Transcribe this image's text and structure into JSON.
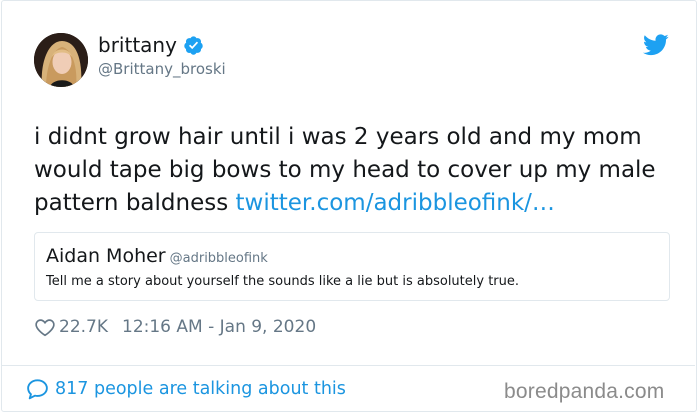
{
  "user": {
    "display_name": "brittany",
    "handle": "@Brittany_broski",
    "avatar_icon": "user-avatar-photo",
    "verified_icon": "verified-badge-icon"
  },
  "brand": {
    "bird_icon": "twitter-bird-icon",
    "accent_color": "#1b95e0"
  },
  "tweet": {
    "text": "i didnt grow hair until i was 2 years old and my mom would tape big bows to my head to cover up my male pattern baldness ",
    "link": "twitter.com/adribbleofink/…"
  },
  "quoted_tweet": {
    "name": "Aidan Moher",
    "handle": "@adribbleofink",
    "text": "Tell me a story about yourself the sounds like a lie but is absolutely true."
  },
  "meta": {
    "likes": "22.7K",
    "timestamp": "12:16 AM - Jan 9, 2020",
    "heart_icon": "heart-icon"
  },
  "footer": {
    "conversation_text": "817 people are talking about this",
    "bubble_icon": "speech-bubble-icon",
    "watermark": "boredpanda.com"
  }
}
